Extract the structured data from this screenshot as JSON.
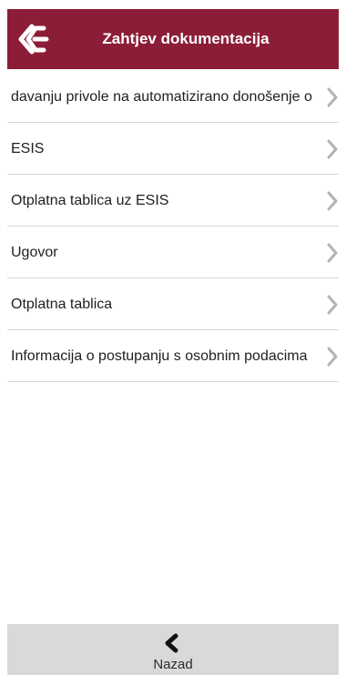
{
  "header": {
    "title": "Zahtjev dokumentacija",
    "logo_icon": "bank-logo-icon",
    "background_color": "#8c1d36",
    "title_color": "#ffffff"
  },
  "list": {
    "items": [
      {
        "label": "davanju privole na automatizirano donošenje o",
        "icon": "chevron-right-icon"
      },
      {
        "label": "ESIS",
        "icon": "chevron-right-icon"
      },
      {
        "label": "Otplatna tablica uz ESIS",
        "icon": "chevron-right-icon"
      },
      {
        "label": "Ugovor",
        "icon": "chevron-right-icon"
      },
      {
        "label": "Otplatna tablica",
        "icon": "chevron-right-icon"
      },
      {
        "label": "Informacija o postupanju s osobnim podacima",
        "icon": "chevron-right-icon"
      }
    ]
  },
  "footer": {
    "back_label": "Nazad",
    "back_icon": "chevron-left-icon",
    "background_color": "#d9d9d9"
  }
}
